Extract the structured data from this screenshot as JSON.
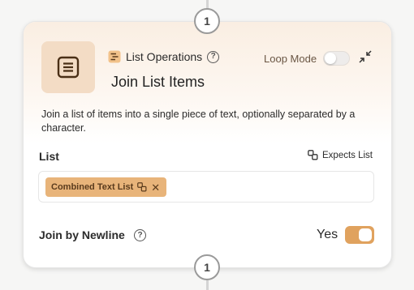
{
  "step_top": "1",
  "step_bottom": "1",
  "node": {
    "category_label": "List Operations",
    "category_icon": "list-operations-icon",
    "main_icon": "document-lines-icon",
    "loop_mode_label": "Loop Mode",
    "loop_mode_enabled": false,
    "title": "Join List Items",
    "description": "Join a list of items into a single piece of text, optionally separated by a character."
  },
  "list_input": {
    "label": "List",
    "expects_label": "Expects List",
    "chip_label": "Combined Text List"
  },
  "join_newline": {
    "label": "Join by Newline",
    "value_label": "Yes",
    "enabled": true
  },
  "colors": {
    "accent": "#e0a25e",
    "chip_bg": "#e8b47a",
    "icon_box_bg": "#f3dcc5"
  }
}
